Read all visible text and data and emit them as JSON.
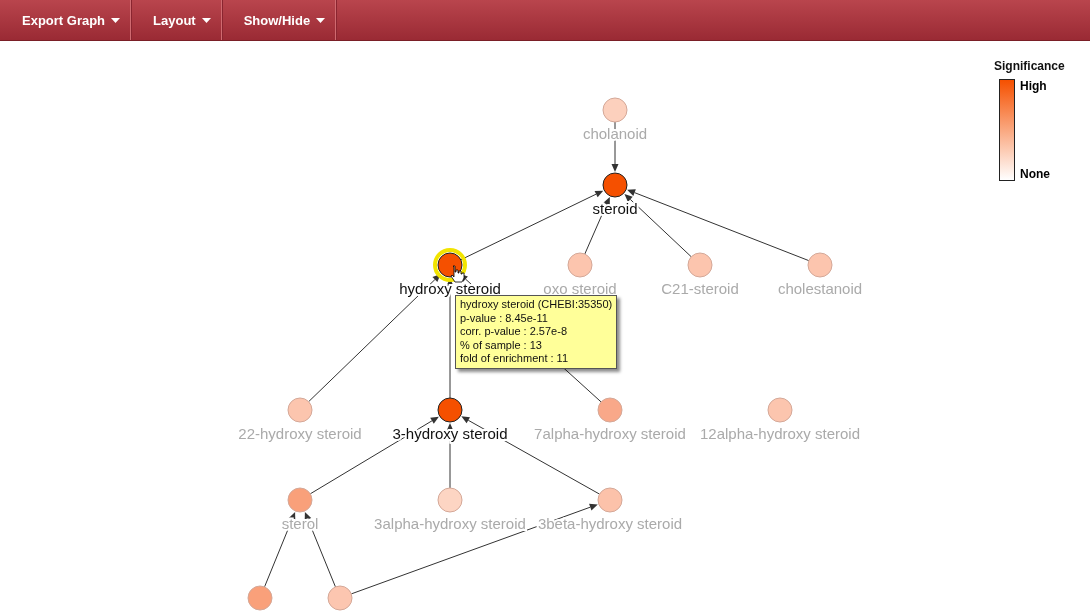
{
  "toolbar": {
    "menus": [
      {
        "label": "Export Graph"
      },
      {
        "label": "Layout"
      },
      {
        "label": "Show/Hide"
      }
    ]
  },
  "legend": {
    "title": "Significance",
    "high_label": "High",
    "low_label": "None"
  },
  "graph": {
    "nodes": [
      {
        "label": "cholanoid",
        "color": "#fcd0bd",
        "significant": false,
        "hovered": false
      },
      {
        "label": "steroid",
        "color": "#f55000",
        "significant": true,
        "hovered": false
      },
      {
        "label": "hydroxy steroid",
        "color": "#f55000",
        "significant": true,
        "hovered": true
      },
      {
        "label": "oxo steroid",
        "color": "#fcc5ae",
        "significant": false,
        "hovered": false
      },
      {
        "label": "C21-steroid",
        "color": "#fcc5ae",
        "significant": false,
        "hovered": false
      },
      {
        "label": "cholestanoid",
        "color": "#fcc5ae",
        "significant": false,
        "hovered": false
      },
      {
        "label": "22-hydroxy steroid",
        "color": "#fcc5ae",
        "significant": false,
        "hovered": false
      },
      {
        "label": "3-hydroxy steroid",
        "color": "#f55000",
        "significant": true,
        "hovered": false
      },
      {
        "label": "7alpha-hydroxy steroid",
        "color": "#f9a889",
        "significant": false,
        "hovered": false
      },
      {
        "label": "12alpha-hydroxy steroid",
        "color": "#fcc5ae",
        "significant": false,
        "hovered": false
      },
      {
        "label": "sterol",
        "color": "#f9a07a",
        "significant": false,
        "hovered": false
      },
      {
        "label": "3alpha-hydroxy steroid",
        "color": "#fdd5c3",
        "significant": false,
        "hovered": false
      },
      {
        "label": "3beta-hydroxy steroid",
        "color": "#fcc2aa",
        "significant": false,
        "hovered": false
      },
      {
        "color": "#f9a07a",
        "significant": false,
        "hovered": false
      },
      {
        "color": "#fcc6b0",
        "significant": false,
        "hovered": false
      }
    ]
  },
  "tooltip": {
    "lines": [
      "hydroxy steroid (CHEBI:35350)",
      "p-value : 8.45e-11",
      "corr. p-value : 2.57e-8",
      "% of sample : 13",
      "fold of enrichment : 11"
    ]
  }
}
